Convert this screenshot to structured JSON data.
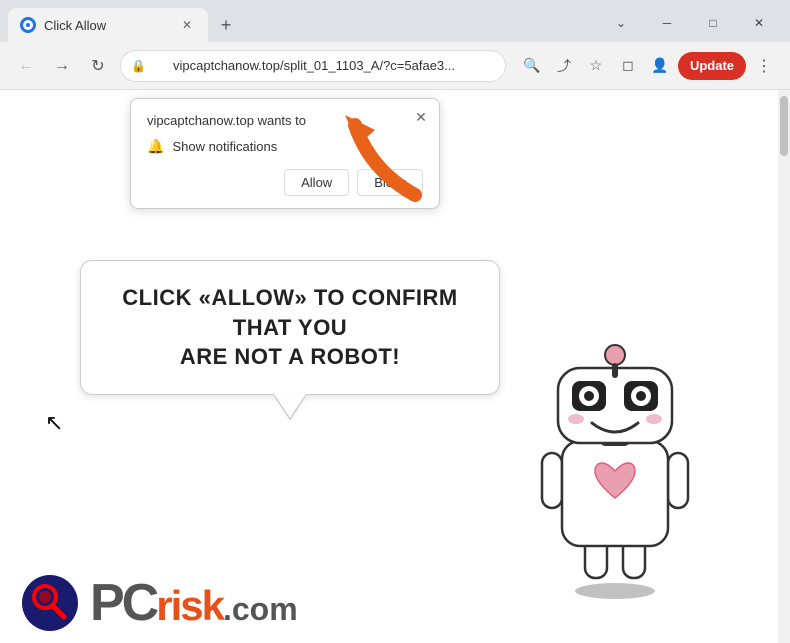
{
  "browser": {
    "tab": {
      "title": "Click Allow",
      "favicon_label": "globe-icon"
    },
    "address": {
      "url": "vipcaptchanow.top/split_01_1103_A/?c=5afae3...",
      "lock_icon": "🔒"
    },
    "buttons": {
      "back": "←",
      "forward": "→",
      "reload": "↻",
      "new_tab": "+",
      "search": "🔍",
      "share": "↗",
      "bookmark": "☆",
      "extensions": "◻",
      "profile": "👤",
      "update": "Update",
      "menu": "⋮",
      "minimize": "─",
      "maximize": "□",
      "close": "✕"
    },
    "window_controls": {
      "minimize": "─",
      "maximize": "□",
      "close": "✕"
    }
  },
  "notification_popup": {
    "site_text": "vipcaptchanow.top wants to",
    "notification_row": "Show notifications",
    "allow_btn": "Allow",
    "block_btn": "Block",
    "close_btn": "✕"
  },
  "speech_bubble": {
    "line1": "CLICK «ALLOW» TO CONFIRM THAT YOU",
    "line2": "ARE NOT A ROBOT!"
  },
  "pcrisk": {
    "pc": "PC",
    "risk": "risk",
    "com": ".com"
  },
  "colors": {
    "orange_arrow": "#e8621a",
    "update_btn": "#d93025",
    "bubble_border": "#cccccc",
    "pcrisk_orange": "#e8501a"
  }
}
